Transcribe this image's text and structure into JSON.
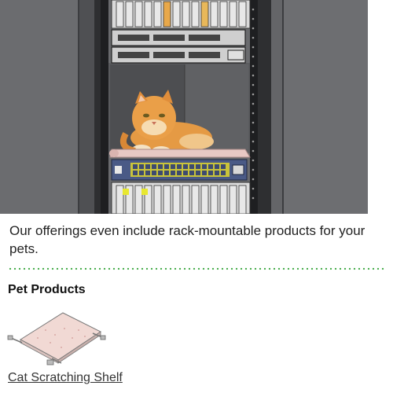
{
  "hero": {
    "image": "cat-in-server-rack-photo"
  },
  "caption": "Our offerings even include rack-mountable products for your pets.",
  "section": {
    "title": "Pet Products"
  },
  "products": [
    {
      "name": "Cat Scratching Shelf",
      "image": "rack-shelf-illustration"
    }
  ],
  "colors": {
    "divider_dots": "#4caf50",
    "rack_dark": "#3a3a3a",
    "cabinet_gray": "#5a5b5e",
    "switch_blue": "#4a5a86",
    "port_yellow": "#d8d820",
    "shelf_pink": "#e8c8c4"
  }
}
